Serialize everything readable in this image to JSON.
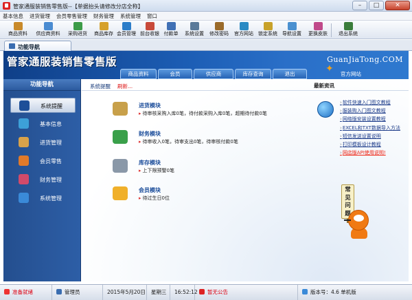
{
  "window": {
    "title": "管家通服装销售零售版--【单据抬头请修改分店全称】",
    "minimize": "–",
    "maximize": "□",
    "close": "✕"
  },
  "menu": [
    "基本信息",
    "进货管理",
    "会员零售管理",
    "财务管理",
    "系统管理",
    "窗口"
  ],
  "toolbar": {
    "items": [
      {
        "label": "商品资料",
        "icon": "goods-icon",
        "color": "#c98a2a"
      },
      {
        "label": "供应商资料",
        "icon": "supplier-icon",
        "color": "#4a8bd1"
      },
      {
        "label": "采购进货",
        "icon": "purchase-icon",
        "color": "#3c9b48"
      },
      {
        "label": "商品库存",
        "icon": "stock-icon",
        "color": "#d6a12c"
      },
      {
        "label": "会员管理",
        "icon": "member-icon",
        "color": "#2c7dc9"
      },
      {
        "label": "前台收银",
        "icon": "cashier-icon",
        "color": "#c84a3a"
      },
      {
        "label": "付款单",
        "icon": "payment-icon",
        "color": "#4070b5"
      },
      {
        "label": "系统设置",
        "icon": "settings-icon",
        "color": "#5a7a9a"
      },
      {
        "label": "修改密码",
        "icon": "password-icon",
        "color": "#9a6a2a"
      },
      {
        "label": "官方网站",
        "icon": "website-icon",
        "color": "#2a8ac4"
      },
      {
        "label": "锁定系统",
        "icon": "lock-icon",
        "color": "#c8a22a"
      },
      {
        "label": "导航设置",
        "icon": "nav-settings-icon",
        "color": "#4a90d0"
      },
      {
        "label": "更换皮肤",
        "icon": "skin-icon",
        "color": "#c04a8a"
      },
      {
        "label": "退出系统",
        "icon": "exit-icon",
        "color": "#3b7d3b"
      }
    ]
  },
  "tab": {
    "label": "功能导航"
  },
  "banner": {
    "title": "管家通服装销售零售版",
    "url": "GuanJiaTong.COM",
    "nav": [
      "商品资料",
      "会员",
      "供应商",
      "库存查询",
      "退出"
    ],
    "official": "官方网站"
  },
  "sidebar": {
    "header": "功能导航",
    "items": [
      {
        "label": "系统提醒",
        "icon": "info-icon",
        "color": "#1d4f98",
        "active": true
      },
      {
        "label": "基本信息",
        "icon": "cubes-icon",
        "color": "#3da0d8"
      },
      {
        "label": "进货管理",
        "icon": "box-icon",
        "color": "#d8a24a"
      },
      {
        "label": "会员零售",
        "icon": "bag-icon",
        "color": "#e07a2a"
      },
      {
        "label": "财务管理",
        "icon": "finance-icon",
        "color": "#d24a6a"
      },
      {
        "label": "系统管理",
        "icon": "system-icon",
        "color": "#3a8ad8"
      }
    ]
  },
  "content": {
    "tab": "系统提醒",
    "refresh": "刷新...",
    "news_title": "最新资讯",
    "modules": [
      {
        "title": "进货模块",
        "line": "待审核采购入库0笔，待付款采购入库0笔，超期待付款0笔",
        "icon": "purchase-module-icon",
        "color": "#c8a04a"
      },
      {
        "title": "财务模块",
        "line": "待审收入0笔，待审支出0笔，待审核付款0笔",
        "icon": "finance-module-icon",
        "color": "#3aa04a"
      },
      {
        "title": "库存模块",
        "line": "上下限预警0笔",
        "icon": "stock-module-icon",
        "color": "#8a98a8"
      },
      {
        "title": "会员模块",
        "line": "待过生日0位",
        "icon": "member-module-icon",
        "color": "#f0b02a"
      }
    ],
    "news": [
      {
        "text": "软件快速入门图文教程"
      },
      {
        "text": "服装购入门图文教程"
      },
      {
        "text": "网络版安装设置教程"
      },
      {
        "text": "EXCEL和TXT数据导入方法"
      },
      {
        "text": "短信发送设置说明"
      },
      {
        "text": "打印模板设计教程"
      },
      {
        "text": "网店版API使用说明!",
        "red": true
      }
    ],
    "faq": [
      "常",
      "见",
      "问",
      "题"
    ]
  },
  "status": {
    "state": "准备就绪",
    "user": "管理员",
    "date": "2015年5月20日",
    "weekday": "星期三",
    "time": "16:52:12",
    "notice": "暂无公告",
    "version": "版本号：4.6 单机版"
  },
  "colors": {
    "banner_dark": "#0f3f88",
    "banner_light": "#2f79cf",
    "sidebar": "#2d5ea6",
    "link": "#1d3c8a",
    "alert": "#e21"
  }
}
